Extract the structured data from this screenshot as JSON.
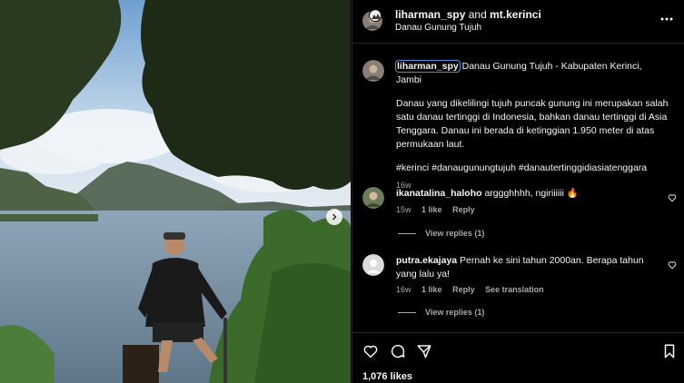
{
  "post": {
    "author": "liharman_spy",
    "collab_joiner": "and",
    "collaborator": "mt.kerinci",
    "location": "Danau Gunung Tujuh",
    "caption": {
      "username": "liharman_spy",
      "title": "Danau Gunung Tujuh - Kabupaten Kerinci, Jambi",
      "body": "Danau yang dikelilingi tujuh puncak gunung ini merupakan salah satu danau tertinggi di Indonesia, bahkan danau tertinggi di Asia Tenggara. Danau ini berada di ketinggian 1.950 meter di atas permukaan laut.",
      "hashtags": "#kerinci #danaugunungtujuh #danautertinggidiasiatenggara",
      "time": "16w"
    },
    "likes": "1,076 likes"
  },
  "comments": [
    {
      "username": "ikanatalina_haloho",
      "text": "arggghhhh, ngiriiiiii 🔥",
      "time": "15w",
      "likes": "1 like",
      "reply": "Reply",
      "view_replies": "View replies (1)"
    },
    {
      "username": "putra.ekajaya",
      "text": "Pernah ke sini tahun 2000an. Berapa tahun yang lalu ya!",
      "time": "16w",
      "likes": "1 like",
      "reply": "Reply",
      "translate": "See translation",
      "view_replies": "View replies (1)"
    }
  ],
  "icons": {
    "more": "more-horizontal-icon",
    "like": "heart-icon",
    "comment": "comment-icon",
    "share": "send-icon",
    "save": "bookmark-icon",
    "next": "chevron-right-icon"
  },
  "colors": {
    "background": "#000000",
    "text": "#f5f5f5",
    "muted": "#a8a8a8",
    "divider": "#262626",
    "focus_outline": "#4a90e2"
  }
}
